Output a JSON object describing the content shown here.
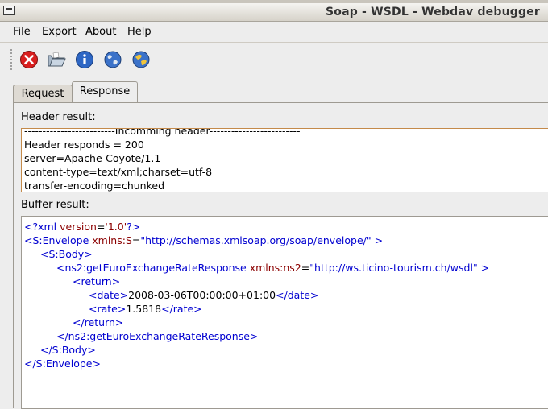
{
  "window": {
    "title": "Soap - WSDL - Webdav debugger"
  },
  "menu": [
    {
      "label": "File"
    },
    {
      "label": "Export"
    },
    {
      "label": "About"
    },
    {
      "label": "Help"
    }
  ],
  "toolbar": {
    "icons": [
      "close-red-icon",
      "open-folder-icon",
      "info-icon",
      "globe-icon",
      "globe-icon"
    ]
  },
  "tabs": [
    {
      "label": "Request",
      "active": false
    },
    {
      "label": "Response",
      "active": true
    }
  ],
  "header_result": {
    "label": "Header result:",
    "lines": [
      "-------------------------Incomming header-------------------------",
      "Header responds = 200",
      "server=Apache-Coyote/1.1",
      "content-type=text/xml;charset=utf-8",
      "transfer-encoding=chunked"
    ]
  },
  "buffer_result": {
    "label": "Buffer result:",
    "xml": {
      "decl_open": "<?xml ",
      "decl_attr": "version",
      "decl_eq": "=",
      "decl_val": "'1.0'",
      "decl_close": "?>",
      "envelope_open": "<S:Envelope ",
      "envelope_attr": "xmlns:S",
      "envelope_eq": "=",
      "envelope_val": "\"http://schemas.xmlsoap.org/soap/envelope/\"",
      "envelope_close": " >",
      "body_open": "<S:Body>",
      "resp_open": "<ns2:getEuroExchangeRateResponse ",
      "resp_attr": "xmlns:ns2",
      "resp_eq": "=",
      "resp_val": "\"http://ws.ticino-tourism.ch/wsdl\"",
      "resp_close": " >",
      "return_open": "<return>",
      "date_open": "<date>",
      "date_val": "2008-03-06T00:00:00+01:00",
      "date_close": "</date>",
      "rate_open": "<rate>",
      "rate_val": "1.5818",
      "rate_close": "</rate>",
      "return_close": "</return>",
      "resp_end": "</ns2:getEuroExchangeRateResponse>",
      "body_close": "</S:Body>",
      "envelope_end": "</S:Envelope>"
    }
  },
  "colors": {
    "xml_tag": "#0000d0",
    "xml_attr": "#8b0000",
    "header_border": "#c48a4a"
  }
}
